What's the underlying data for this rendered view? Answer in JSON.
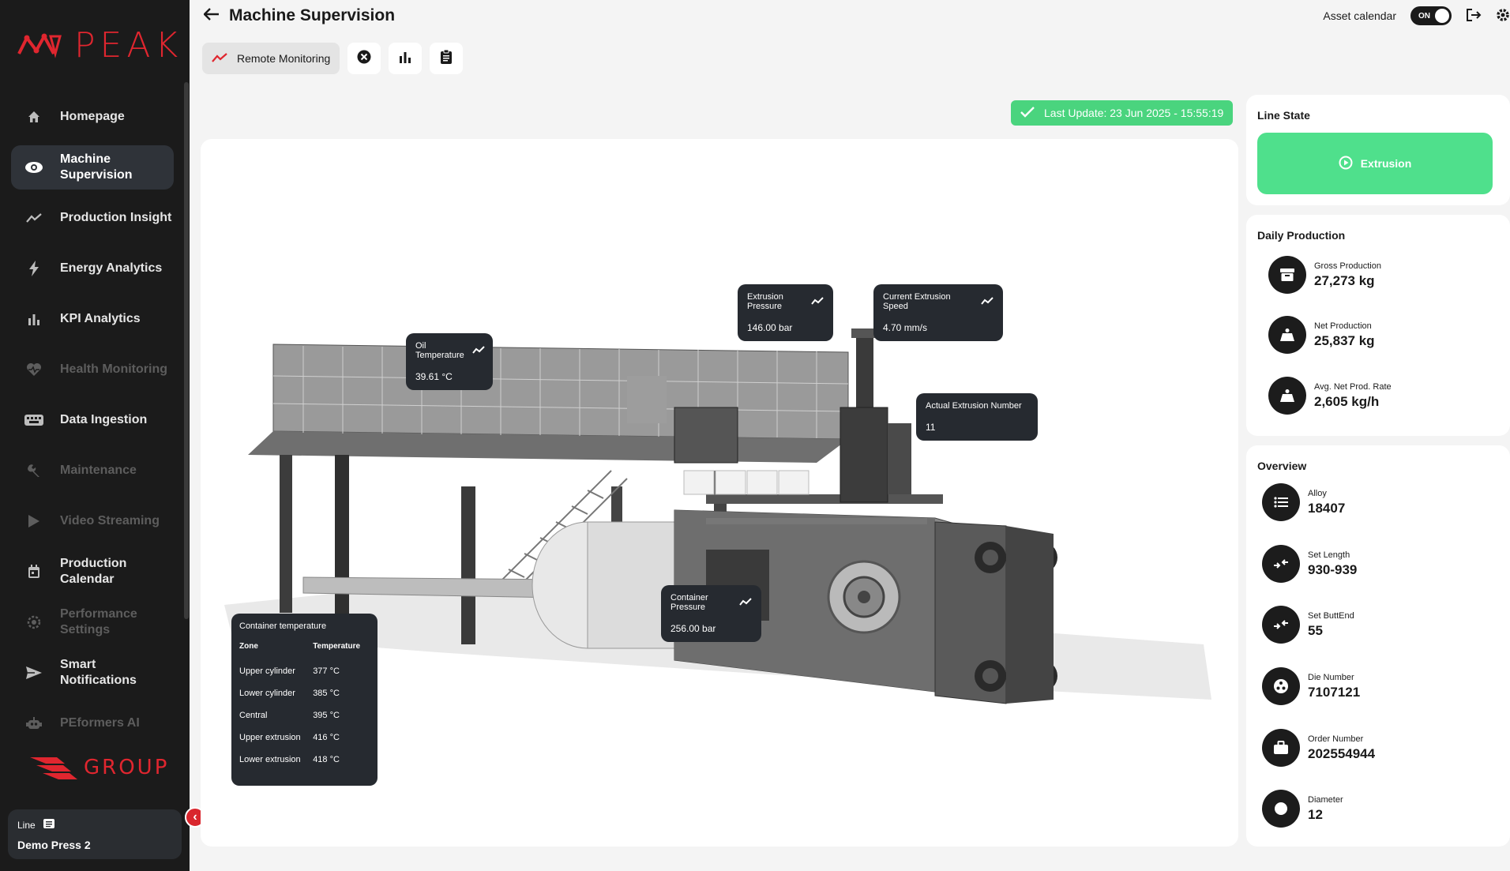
{
  "sidebar": {
    "logo_text": "PEAK",
    "items": [
      {
        "label": "Homepage",
        "icon": "home-icon",
        "state": "normal"
      },
      {
        "label": "Machine\nSupervision",
        "icon": "eye-icon",
        "state": "active"
      },
      {
        "label": "Production Insight",
        "icon": "trend-icon",
        "state": "normal"
      },
      {
        "label": "Energy Analytics",
        "icon": "bolt-icon",
        "state": "normal"
      },
      {
        "label": "KPI Analytics",
        "icon": "bar-chart-icon",
        "state": "normal"
      },
      {
        "label": "Health Monitoring",
        "icon": "heart-pulse-icon",
        "state": "disabled"
      },
      {
        "label": "Data Ingestion",
        "icon": "keyboard-icon",
        "state": "normal"
      },
      {
        "label": "Maintenance",
        "icon": "wrench-icon",
        "state": "disabled"
      },
      {
        "label": "Video Streaming",
        "icon": "play-icon",
        "state": "disabled"
      },
      {
        "label": "Production\nCalendar",
        "icon": "calendar-icon",
        "state": "normal"
      },
      {
        "label": "Performance\nSettings",
        "icon": "settings-icon",
        "state": "disabled"
      },
      {
        "label": "Smart\nNotifications",
        "icon": "send-icon",
        "state": "normal"
      },
      {
        "label": "PEformers AI",
        "icon": "robot-icon",
        "state": "disabled"
      }
    ],
    "group_text": "GROUP",
    "line_label": "Line",
    "line_value": "Demo Press 2"
  },
  "header": {
    "title": "Machine Supervision",
    "asset_calendar_label": "Asset calendar",
    "toggle_label": "ON"
  },
  "toolbar": {
    "tab_label": "Remote Monitoring"
  },
  "last_update": "Last Update: 23 Jun 2025 - 15:55:19",
  "machine": {
    "oil_temperature": {
      "label": "Oil Temperature",
      "value": "39.61 °C"
    },
    "extrusion_pressure": {
      "label": "Extrusion Pressure",
      "value": "146.00 bar"
    },
    "current_extrusion_speed": {
      "label": "Current Extrusion Speed",
      "value": "4.70 mm/s"
    },
    "actual_extrusion_number": {
      "label": "Actual Extrusion Number",
      "value": "11"
    },
    "container_pressure": {
      "label": "Container Pressure",
      "value": "256.00 bar"
    },
    "container_temperature": {
      "title": "Container temperature",
      "headers": [
        "Zone",
        "Temperature"
      ],
      "rows": [
        [
          "Upper cylinder",
          "377 °C"
        ],
        [
          "Lower cylinder",
          "385 °C"
        ],
        [
          "Central",
          "395 °C"
        ],
        [
          "Upper extrusion",
          "416 °C"
        ],
        [
          "Lower extrusion",
          "418 °C"
        ]
      ]
    }
  },
  "line_state": {
    "title": "Line State",
    "state": "Extrusion",
    "color": "#4fe08c"
  },
  "daily_production": {
    "title": "Daily Production",
    "items": [
      {
        "label": "Gross Production",
        "value": "27,273 kg",
        "icon": "archive-icon"
      },
      {
        "label": "Net Production",
        "value": "25,837 kg",
        "icon": "weight-icon"
      },
      {
        "label": "Avg. Net Prod. Rate",
        "value": "2,605 kg/h",
        "icon": "weight-icon"
      }
    ]
  },
  "overview": {
    "title": "Overview",
    "items": [
      {
        "label": "Alloy",
        "value": "18407",
        "icon": "list-icon"
      },
      {
        "label": "Set Length",
        "value": "930-939",
        "icon": "compress-arrows-icon"
      },
      {
        "label": "Set ButtEnd",
        "value": "55",
        "icon": "compress-arrows-icon"
      },
      {
        "label": "Die Number",
        "value": "7107121",
        "icon": "die-icon"
      },
      {
        "label": "Order Number",
        "value": "202554944",
        "icon": "briefcase-icon"
      },
      {
        "label": "Diameter",
        "value": "12",
        "icon": "circle-icon"
      }
    ]
  },
  "colors": {
    "brand_red": "#e0262f",
    "sidebar_bg": "#1b1b1b",
    "success_green": "#4ad47e",
    "tooltip_bg": "#262a30"
  }
}
